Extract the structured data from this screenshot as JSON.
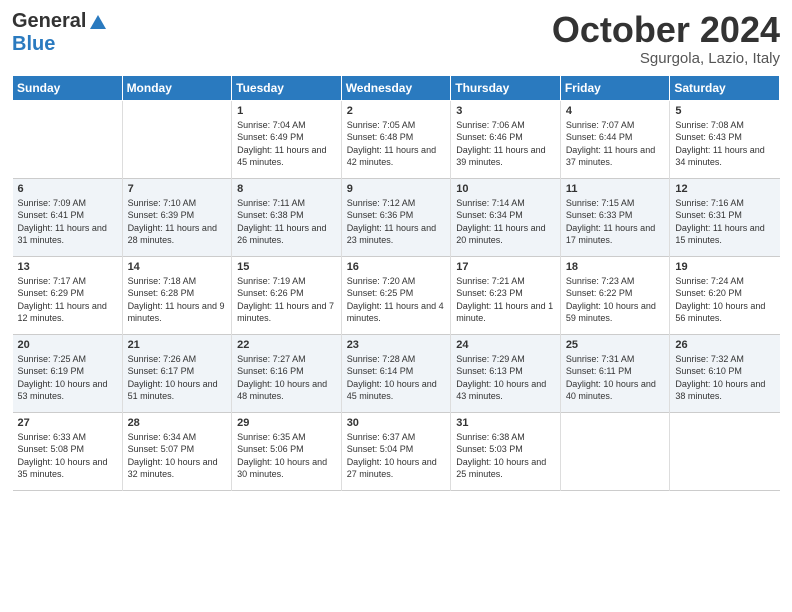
{
  "header": {
    "logo_general": "General",
    "logo_blue": "Blue",
    "month_title": "October 2024",
    "location": "Sgurgola, Lazio, Italy"
  },
  "days_of_week": [
    "Sunday",
    "Monday",
    "Tuesday",
    "Wednesday",
    "Thursday",
    "Friday",
    "Saturday"
  ],
  "weeks": [
    [
      {
        "day": "",
        "text": ""
      },
      {
        "day": "",
        "text": ""
      },
      {
        "day": "1",
        "text": "Sunrise: 7:04 AM\nSunset: 6:49 PM\nDaylight: 11 hours and 45 minutes."
      },
      {
        "day": "2",
        "text": "Sunrise: 7:05 AM\nSunset: 6:48 PM\nDaylight: 11 hours and 42 minutes."
      },
      {
        "day": "3",
        "text": "Sunrise: 7:06 AM\nSunset: 6:46 PM\nDaylight: 11 hours and 39 minutes."
      },
      {
        "day": "4",
        "text": "Sunrise: 7:07 AM\nSunset: 6:44 PM\nDaylight: 11 hours and 37 minutes."
      },
      {
        "day": "5",
        "text": "Sunrise: 7:08 AM\nSunset: 6:43 PM\nDaylight: 11 hours and 34 minutes."
      }
    ],
    [
      {
        "day": "6",
        "text": "Sunrise: 7:09 AM\nSunset: 6:41 PM\nDaylight: 11 hours and 31 minutes."
      },
      {
        "day": "7",
        "text": "Sunrise: 7:10 AM\nSunset: 6:39 PM\nDaylight: 11 hours and 28 minutes."
      },
      {
        "day": "8",
        "text": "Sunrise: 7:11 AM\nSunset: 6:38 PM\nDaylight: 11 hours and 26 minutes."
      },
      {
        "day": "9",
        "text": "Sunrise: 7:12 AM\nSunset: 6:36 PM\nDaylight: 11 hours and 23 minutes."
      },
      {
        "day": "10",
        "text": "Sunrise: 7:14 AM\nSunset: 6:34 PM\nDaylight: 11 hours and 20 minutes."
      },
      {
        "day": "11",
        "text": "Sunrise: 7:15 AM\nSunset: 6:33 PM\nDaylight: 11 hours and 17 minutes."
      },
      {
        "day": "12",
        "text": "Sunrise: 7:16 AM\nSunset: 6:31 PM\nDaylight: 11 hours and 15 minutes."
      }
    ],
    [
      {
        "day": "13",
        "text": "Sunrise: 7:17 AM\nSunset: 6:29 PM\nDaylight: 11 hours and 12 minutes."
      },
      {
        "day": "14",
        "text": "Sunrise: 7:18 AM\nSunset: 6:28 PM\nDaylight: 11 hours and 9 minutes."
      },
      {
        "day": "15",
        "text": "Sunrise: 7:19 AM\nSunset: 6:26 PM\nDaylight: 11 hours and 7 minutes."
      },
      {
        "day": "16",
        "text": "Sunrise: 7:20 AM\nSunset: 6:25 PM\nDaylight: 11 hours and 4 minutes."
      },
      {
        "day": "17",
        "text": "Sunrise: 7:21 AM\nSunset: 6:23 PM\nDaylight: 11 hours and 1 minute."
      },
      {
        "day": "18",
        "text": "Sunrise: 7:23 AM\nSunset: 6:22 PM\nDaylight: 10 hours and 59 minutes."
      },
      {
        "day": "19",
        "text": "Sunrise: 7:24 AM\nSunset: 6:20 PM\nDaylight: 10 hours and 56 minutes."
      }
    ],
    [
      {
        "day": "20",
        "text": "Sunrise: 7:25 AM\nSunset: 6:19 PM\nDaylight: 10 hours and 53 minutes."
      },
      {
        "day": "21",
        "text": "Sunrise: 7:26 AM\nSunset: 6:17 PM\nDaylight: 10 hours and 51 minutes."
      },
      {
        "day": "22",
        "text": "Sunrise: 7:27 AM\nSunset: 6:16 PM\nDaylight: 10 hours and 48 minutes."
      },
      {
        "day": "23",
        "text": "Sunrise: 7:28 AM\nSunset: 6:14 PM\nDaylight: 10 hours and 45 minutes."
      },
      {
        "day": "24",
        "text": "Sunrise: 7:29 AM\nSunset: 6:13 PM\nDaylight: 10 hours and 43 minutes."
      },
      {
        "day": "25",
        "text": "Sunrise: 7:31 AM\nSunset: 6:11 PM\nDaylight: 10 hours and 40 minutes."
      },
      {
        "day": "26",
        "text": "Sunrise: 7:32 AM\nSunset: 6:10 PM\nDaylight: 10 hours and 38 minutes."
      }
    ],
    [
      {
        "day": "27",
        "text": "Sunrise: 6:33 AM\nSunset: 5:08 PM\nDaylight: 10 hours and 35 minutes."
      },
      {
        "day": "28",
        "text": "Sunrise: 6:34 AM\nSunset: 5:07 PM\nDaylight: 10 hours and 32 minutes."
      },
      {
        "day": "29",
        "text": "Sunrise: 6:35 AM\nSunset: 5:06 PM\nDaylight: 10 hours and 30 minutes."
      },
      {
        "day": "30",
        "text": "Sunrise: 6:37 AM\nSunset: 5:04 PM\nDaylight: 10 hours and 27 minutes."
      },
      {
        "day": "31",
        "text": "Sunrise: 6:38 AM\nSunset: 5:03 PM\nDaylight: 10 hours and 25 minutes."
      },
      {
        "day": "",
        "text": ""
      },
      {
        "day": "",
        "text": ""
      }
    ]
  ]
}
